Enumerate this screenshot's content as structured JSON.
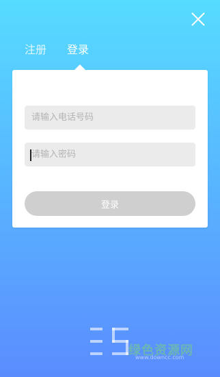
{
  "header": {
    "close_icon": "close-icon"
  },
  "tabs": [
    {
      "label": "注册",
      "active": false
    },
    {
      "label": "登录",
      "active": true
    }
  ],
  "form": {
    "phone_placeholder": "请输入电话号码",
    "password_placeholder": "请输入密码",
    "login_label": "登录"
  },
  "watermark": {
    "logo_text": "绿色资源网",
    "url": "www.downcc.com"
  },
  "colors": {
    "background_top": "#56dcff",
    "background_bottom": "#5b8cff",
    "button_disabled": "#cfcfcf",
    "input_bg": "#ebebeb"
  }
}
